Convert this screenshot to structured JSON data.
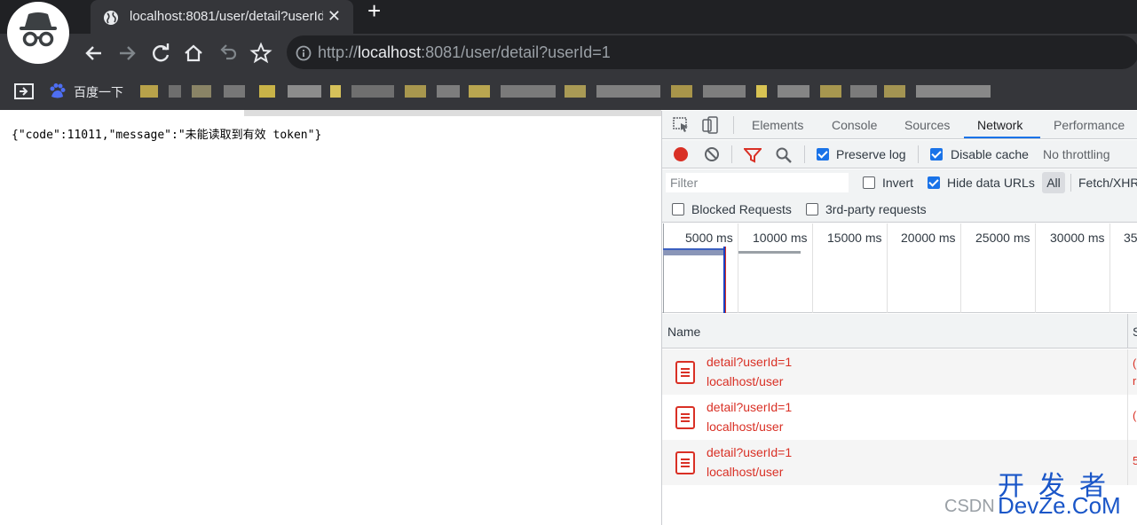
{
  "browser": {
    "tab_title": "localhost:8081/user/detail?userId=1",
    "tab_close": "✕",
    "new_tab": "+",
    "url_scheme": "http://",
    "url_host": "localhost",
    "url_rest": ":8081/user/detail?userId=1",
    "bookmark_label": "百度一下"
  },
  "page": {
    "json_text": "{\"code\":11011,\"message\":\"未能读取到有效 token\"}"
  },
  "devtools": {
    "tabs": [
      "Elements",
      "Console",
      "Sources",
      "Network",
      "Performance"
    ],
    "active_tab": "Network",
    "preserve_log": "Preserve log",
    "disable_cache": "Disable cache",
    "throttling": "No throttling",
    "filter_placeholder": "Filter",
    "invert": "Invert",
    "hide_data_urls": "Hide data URLs",
    "all": "All",
    "fetch_xhr": "Fetch/XHR",
    "blocked_requests": "Blocked Requests",
    "third_party": "3rd-party requests",
    "timeline_labels": [
      "5000 ms",
      "10000 ms",
      "15000 ms",
      "20000 ms",
      "25000 ms",
      "30000 ms",
      "35"
    ],
    "name_header": "Name",
    "name_header_next": "S",
    "requests": [
      {
        "name": "detail?userId=1",
        "host": "localhost/user",
        "status": "(",
        "status2": "r"
      },
      {
        "name": "detail?userId=1",
        "host": "localhost/user",
        "status": "(",
        "status2": ""
      },
      {
        "name": "detail?userId=1",
        "host": "localhost/user",
        "status": "5",
        "status2": ""
      }
    ]
  },
  "watermark": {
    "csdn": "CSDN",
    "cn": "开发者",
    "en": "DevZe.CoM"
  }
}
